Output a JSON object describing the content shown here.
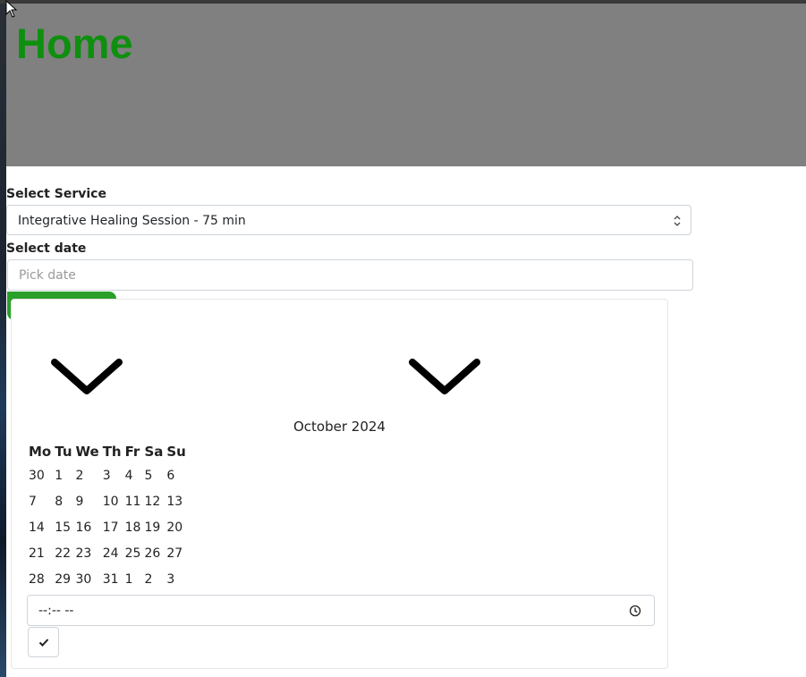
{
  "header": {
    "title": "Home"
  },
  "form": {
    "service_label": "Select Service",
    "service_value": "Integrative Healing Session - 75 min",
    "date_label": "Select date",
    "date_placeholder": "Pick date"
  },
  "datepicker": {
    "month_title": "October 2024",
    "weekdays": [
      "Mo",
      "Tu",
      "We",
      "Th",
      "Fr",
      "Sa",
      "Su"
    ],
    "weeks": [
      [
        "30",
        "1",
        "2",
        "3",
        "4",
        "5",
        "6"
      ],
      [
        "7",
        "8",
        "9",
        "10",
        "11",
        "12",
        "13"
      ],
      [
        "14",
        "15",
        "16",
        "17",
        "18",
        "19",
        "20"
      ],
      [
        "21",
        "22",
        "23",
        "24",
        "25",
        "26",
        "27"
      ],
      [
        "28",
        "29",
        "30",
        "31",
        "1",
        "2",
        "3"
      ]
    ],
    "time_value": "--:-- --"
  },
  "colors": {
    "header_bg": "#808080",
    "title": "#0f8f0f",
    "accent_green": "#2aa02a"
  },
  "icons": {
    "prev": "chevron-down-icon",
    "next": "chevron-down-icon",
    "clock": "clock-icon",
    "confirm": "check-icon",
    "select": "updown-chevron-icon"
  }
}
